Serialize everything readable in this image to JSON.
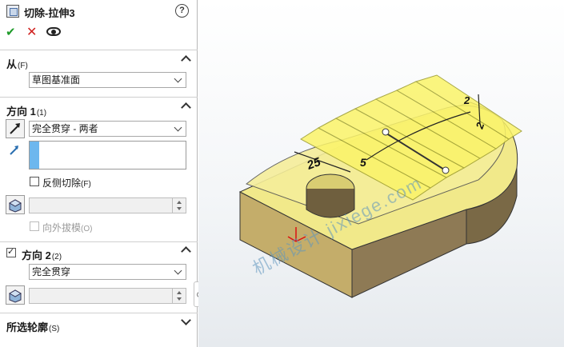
{
  "panel": {
    "title": "切除-拉伸3",
    "help_glyph": "?",
    "ok_glyph": "✔",
    "cancel_glyph": "✕",
    "from": {
      "title": "从",
      "shortcut": "(F)",
      "value": "草图基准面"
    },
    "direction1": {
      "title": "方向 1",
      "shortcut": "(1)",
      "end_condition": "完全贯穿 - 两者",
      "flip_label": "反侧切除",
      "flip_shortcut": "(F)",
      "draft_label": "向外拔模",
      "draft_shortcut": "(O)"
    },
    "direction2": {
      "title": "方向 2",
      "shortcut": "(2)",
      "end_condition": "完全贯穿"
    },
    "selected_contours": {
      "title": "所选轮廓",
      "shortcut": "(S)"
    }
  },
  "viewport": {
    "dimensions": [
      "25",
      "5",
      "2",
      "2"
    ],
    "watermark": "机械设计 jixiege.com"
  },
  "colors": {
    "part_yellow": "#f1e98a",
    "ghost_yellow": "#fbf469",
    "shade_brown": "#8e7a55",
    "accent_blue": "#6db7ee"
  },
  "icons": [
    "feature-icon",
    "help-icon",
    "ok-icon",
    "cancel-icon",
    "eye-icon",
    "reverse-direction-icon",
    "direction-arrow-icon",
    "draft-icon",
    "triad-icon"
  ]
}
